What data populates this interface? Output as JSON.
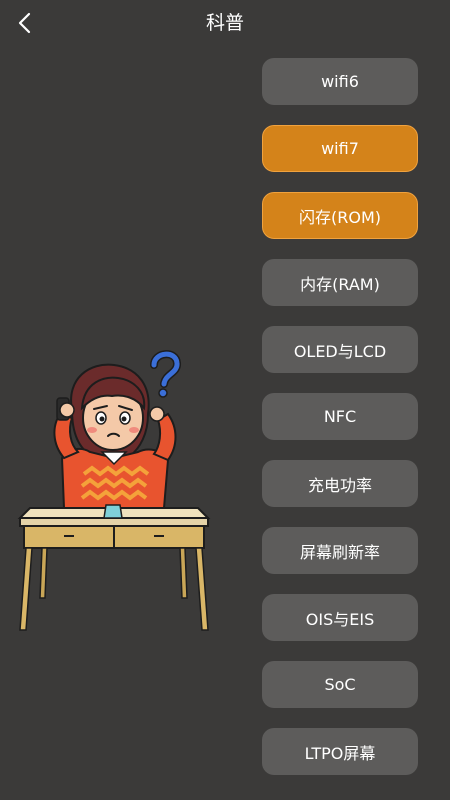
{
  "header": {
    "title": "科普"
  },
  "colors": {
    "background": "#3b3a39",
    "button": "#5d5c5b",
    "active": "#d4831a"
  },
  "topics": [
    {
      "label": "wifi6",
      "active": false
    },
    {
      "label": "wifi7",
      "active": true
    },
    {
      "label": "闪存(ROM)",
      "active": true
    },
    {
      "label": "内存(RAM)",
      "active": false
    },
    {
      "label": "OLED与LCD",
      "active": false
    },
    {
      "label": "NFC",
      "active": false
    },
    {
      "label": "充电功率",
      "active": false
    },
    {
      "label": "屏幕刷新率",
      "active": false
    },
    {
      "label": "OIS与EIS",
      "active": false
    },
    {
      "label": "SoC",
      "active": false
    },
    {
      "label": "LTPO屏幕",
      "active": false
    }
  ]
}
